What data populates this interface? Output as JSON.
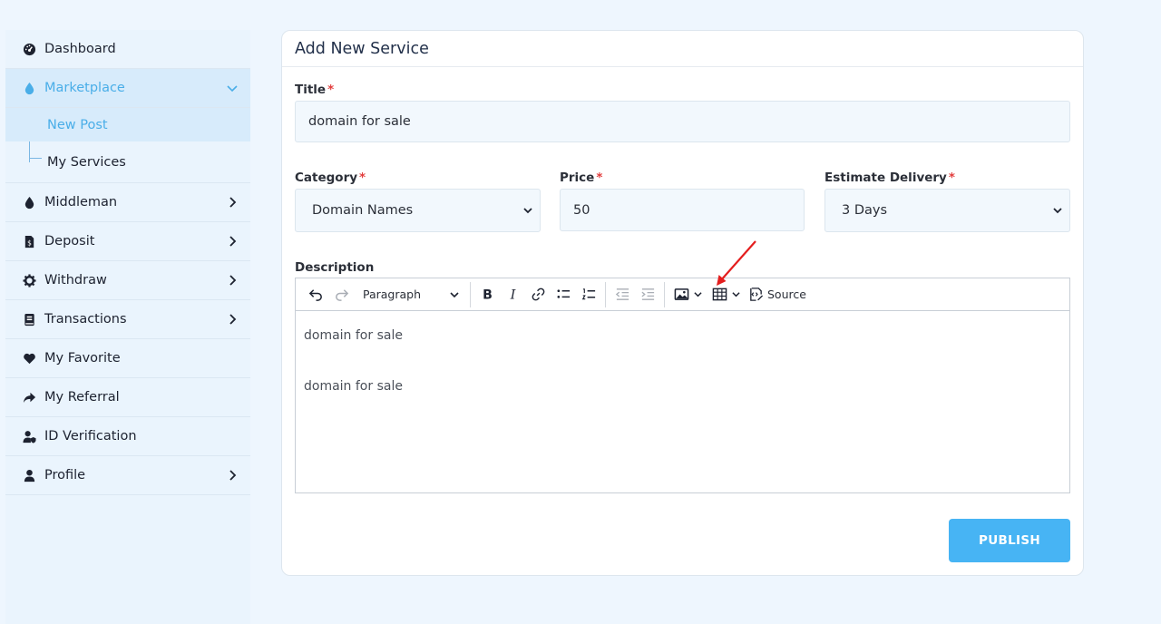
{
  "sidebar": {
    "dashboard": "Dashboard",
    "marketplace": "Marketplace",
    "sub": {
      "new_post": "New Post",
      "my_services": "My Services"
    },
    "middleman": "Middleman",
    "deposit": "Deposit",
    "withdraw": "Withdraw",
    "transactions": "Transactions",
    "my_favorite": "My Favorite",
    "my_referral": "My Referral",
    "id_verification": "ID Verification",
    "profile": "Profile"
  },
  "form": {
    "title": "Add New Service",
    "title_label": "Title",
    "title_value": "domain for sale",
    "category_label": "Category",
    "category_value": "Domain Names",
    "price_label": "Price",
    "price_value": "50",
    "delivery_label": "Estimate Delivery",
    "delivery_value": "3 Days",
    "required_mark": "*",
    "description_label": "Description",
    "publish_label": "PUBLISH"
  },
  "editor": {
    "paragraph_style": "Paragraph",
    "source_label": "Source",
    "lines": [
      "domain for sale",
      "domain for sale"
    ]
  },
  "colors": {
    "accent": "#47b4f4",
    "active_text": "#4aaee8",
    "required": "#e23d3d",
    "annotation_arrow": "#e41e1e"
  }
}
